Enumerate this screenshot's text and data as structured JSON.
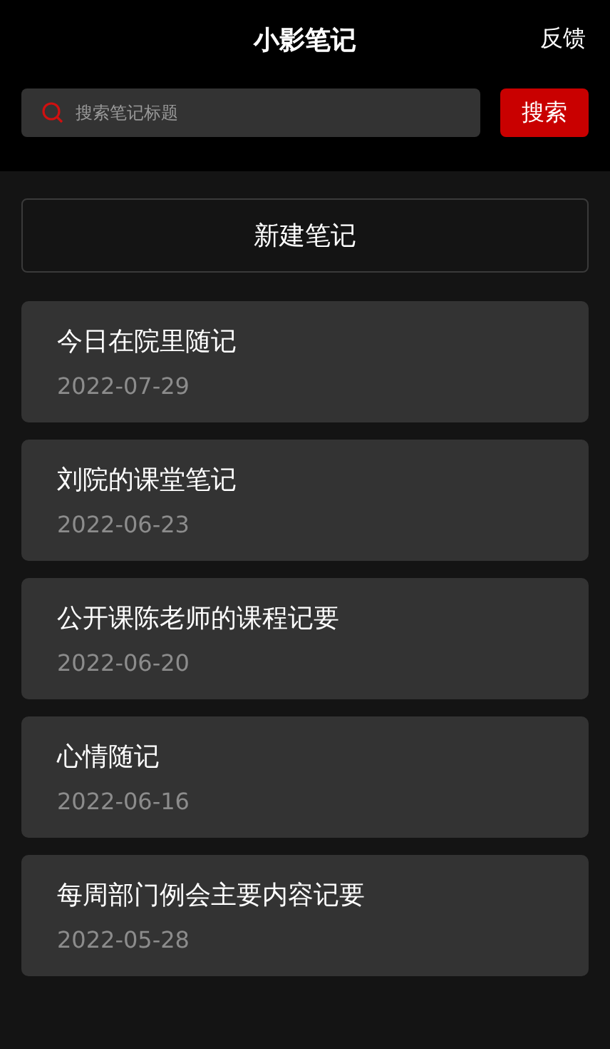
{
  "header": {
    "title": "小影笔记",
    "feedback": "反馈"
  },
  "search": {
    "placeholder": "搜索笔记标题",
    "button": "搜索"
  },
  "new_note_button": "新建笔记",
  "notes": [
    {
      "title": "今日在院里随记",
      "date": "2022-07-29"
    },
    {
      "title": "刘院的课堂笔记",
      "date": "2022-06-23"
    },
    {
      "title": "公开课陈老师的课程记要",
      "date": "2022-06-20"
    },
    {
      "title": "心情随记",
      "date": "2022-06-16"
    },
    {
      "title": "每周部门例会主要内容记要",
      "date": "2022-05-28"
    }
  ]
}
